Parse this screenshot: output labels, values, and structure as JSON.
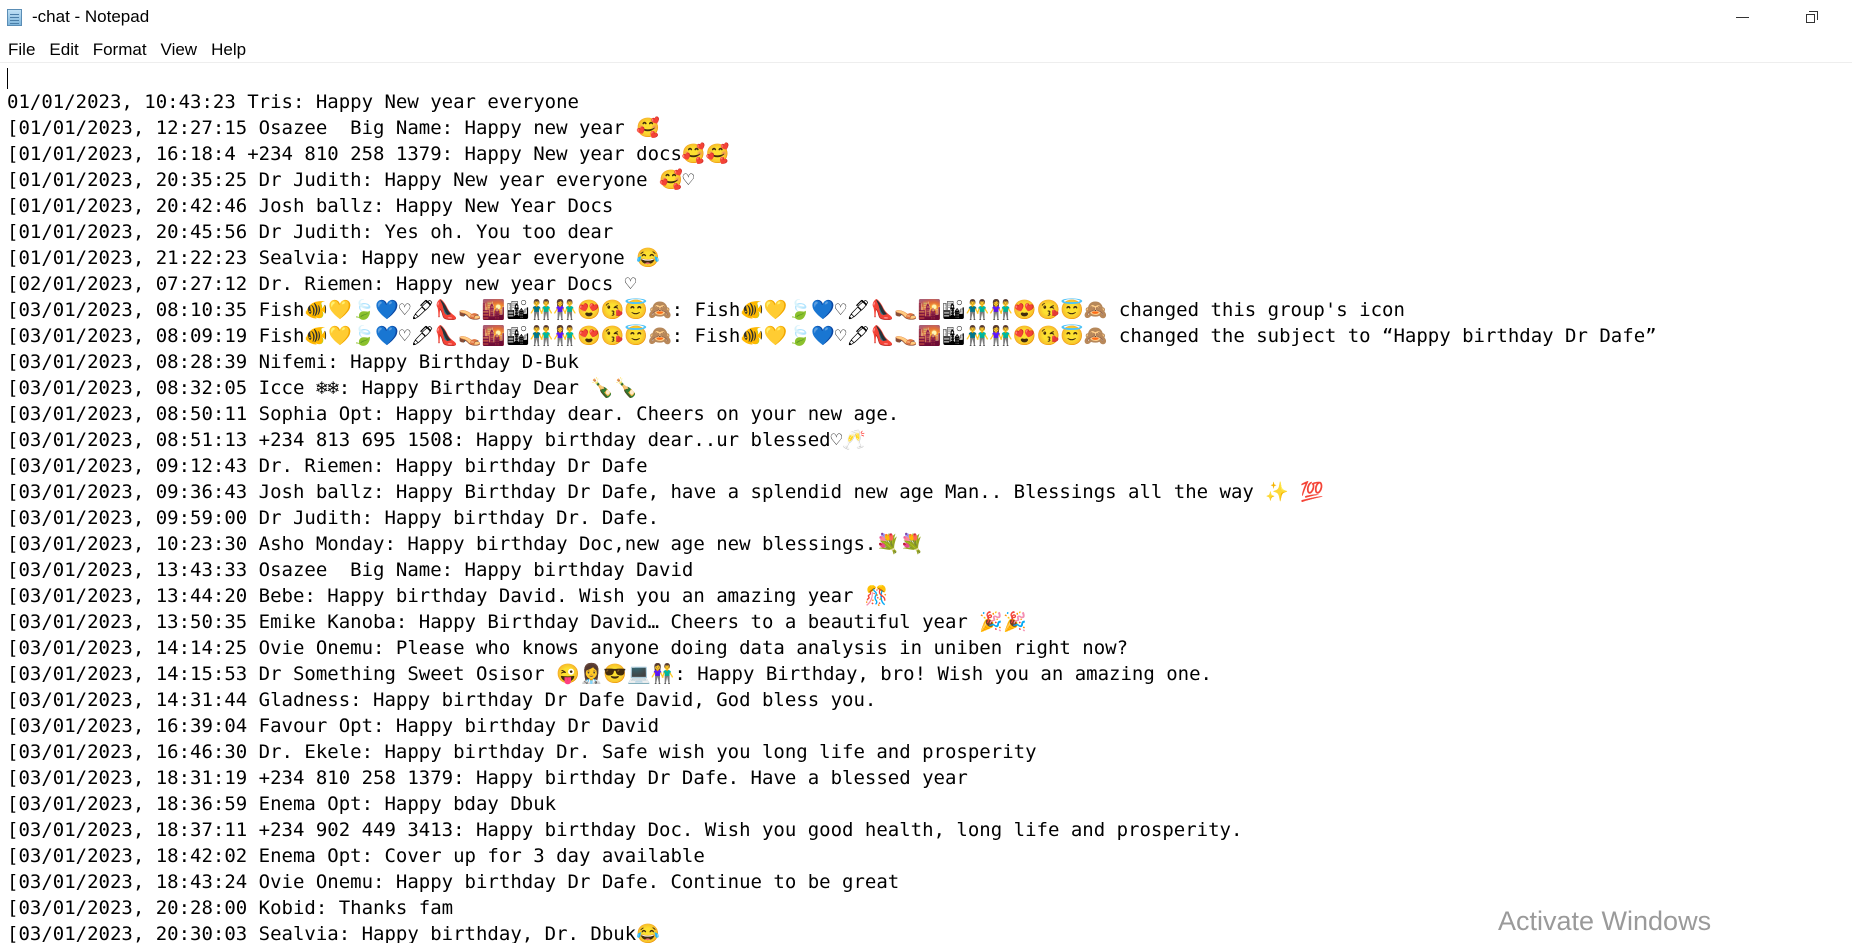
{
  "window": {
    "title": "-chat - Notepad",
    "icon": "notepad-icon",
    "controls": [
      "minimize-icon",
      "restore-icon"
    ]
  },
  "menu": {
    "items": [
      "File",
      "Edit",
      "Format",
      "View",
      "Help"
    ]
  },
  "editor": {
    "lines": [
      "01/01/2023, 10:43:23 Tris: Happy New year everyone",
      "[01/01/2023, 12:27:15 Osazee  Big Name: Happy new year 🥰",
      "[01/01/2023, 16:18:4 +234 810 258 1379: Happy New year docs🥰🥰",
      "[01/01/2023, 20:35:25 Dr Judith: Happy New year everyone 🥰♡",
      "[01/01/2023, 20:42:46 Josh ballz: Happy New Year Docs",
      "[01/01/2023, 20:45:56 Dr Judith: Yes oh. You too dear",
      "[01/01/2023, 21:22:23 Sealvia: Happy new year everyone 😂",
      "[02/01/2023, 07:27:12 Dr. Riemen: Happy new year Docs ♡",
      "[03/01/2023, 08:10:35 Fish🐠💛🍃💙♡🖊👠👡🌇🏙👬👫😍😘😇🙈: Fish🐠💛🍃💙♡🖊👠👡🌇🏙👬👫😍😘😇🙈 changed this group's icon",
      "[03/01/2023, 08:09:19 Fish🐠💛🍃💙♡🖊👠👡🌇🏙👬👫😍😘😇🙈: Fish🐠💛🍃💙♡🖊👠👡🌇🏙👬👫😍😘😇🙈 changed the subject to “Happy birthday Dr Dafe”",
      "[03/01/2023, 08:28:39 Nifemi: Happy Birthday D-Buk",
      "[03/01/2023, 08:32:05 Icce ❄❄: Happy Birthday Dear 🍾🍾",
      "[03/01/2023, 08:50:11 Sophia Opt: Happy birthday dear. Cheers on your new age.",
      "[03/01/2023, 08:51:13 +234 813 695 1508: Happy birthday dear..ur blessed♡🥂",
      "[03/01/2023, 09:12:43 Dr. Riemen: Happy birthday Dr Dafe",
      "[03/01/2023, 09:36:43 Josh ballz: Happy Birthday Dr Dafe, have a splendid new age Man.. Blessings all the way ✨ 💯",
      "[03/01/2023, 09:59:00 Dr Judith: Happy birthday Dr. Dafe.",
      "[03/01/2023, 10:23:30 Asho Monday: Happy birthday Doc,new age new blessings.💐💐",
      "[03/01/2023, 13:43:33 Osazee  Big Name: Happy birthday David",
      "[03/01/2023, 13:44:20 Bebe: Happy birthday David. Wish you an amazing year 🎊",
      "[03/01/2023, 13:50:35 Emike Kanoba: Happy Birthday David… Cheers to a beautiful year 🎉🎉",
      "[03/01/2023, 14:14:25 Ovie Onemu: Please who knows anyone doing data analysis in uniben right now?",
      "[03/01/2023, 14:15:53 Dr Something Sweet Osisor 😜👩‍⚕😎💻👫: Happy Birthday, bro! Wish you an amazing one.",
      "[03/01/2023, 14:31:44 Gladness: Happy birthday Dr Dafe David, God bless you.",
      "[03/01/2023, 16:39:04 Favour Opt: Happy birthday Dr David",
      "[03/01/2023, 16:46:30 Dr. Ekele: Happy birthday Dr. Safe wish you long life and prosperity",
      "[03/01/2023, 18:31:19 +234 810 258 1379: Happy birthday Dr Dafe. Have a blessed year",
      "[03/01/2023, 18:36:59 Enema Opt: Happy bday Dbuk",
      "[03/01/2023, 18:37:11 +234 902 449 3413: Happy birthday Doc. Wish you good health, long life and prosperity.",
      "[03/01/2023, 18:42:02 Enema Opt: Cover up for 3 day available",
      "[03/01/2023, 18:43:24 Ovie Onemu: Happy birthday Dr Dafe. Continue to be great",
      "[03/01/2023, 20:28:00 Kobid: Thanks fam",
      "[03/01/2023, 20:30:03 Sealvia: Happy birthday, Dr. Dbuk😂"
    ]
  },
  "watermark": {
    "text": "Activate Windows"
  }
}
